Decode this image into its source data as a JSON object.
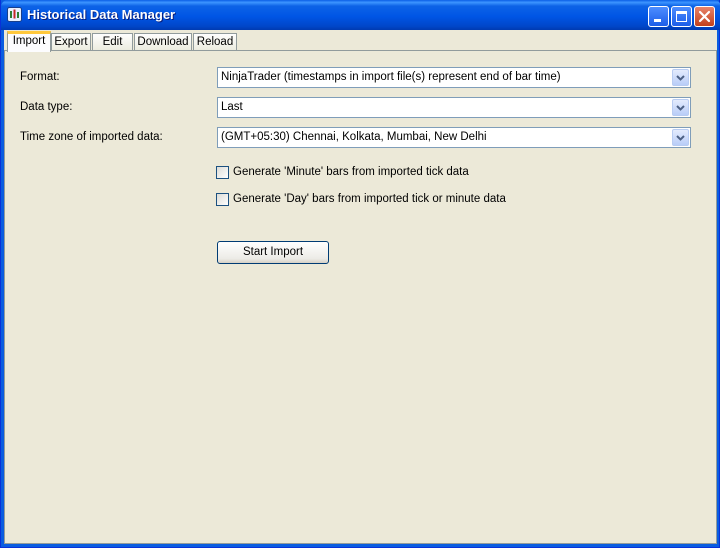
{
  "window": {
    "title": "Historical Data Manager"
  },
  "titlebar_buttons": {
    "minimize": "minimize-icon",
    "maximize": "maximize-icon",
    "close": "close-icon"
  },
  "tabs": [
    {
      "label": "Import",
      "active": true
    },
    {
      "label": "Export",
      "active": false
    },
    {
      "label": "Edit",
      "active": false
    },
    {
      "label": "Download",
      "active": false
    },
    {
      "label": "Reload",
      "active": false
    }
  ],
  "import": {
    "format_label": "Format:",
    "format_value": "NinjaTrader (timestamps in import file(s) represent end of bar time)",
    "datatype_label": "Data type:",
    "datatype_value": "Last",
    "timezone_label": "Time zone of imported data:",
    "timezone_value": "(GMT+05:30) Chennai, Kolkata, Mumbai, New Delhi",
    "minute_bars_label": "Generate 'Minute' bars from imported tick data",
    "minute_bars_checked": false,
    "day_bars_label": "Generate 'Day' bars from imported tick or minute data",
    "day_bars_checked": false,
    "start_button": "Start Import"
  },
  "colors": {
    "titlebar": "#0055e5",
    "client": "#ece9d8",
    "active_tab_accent": "#ffc83c",
    "close_button": "#c3401b"
  }
}
